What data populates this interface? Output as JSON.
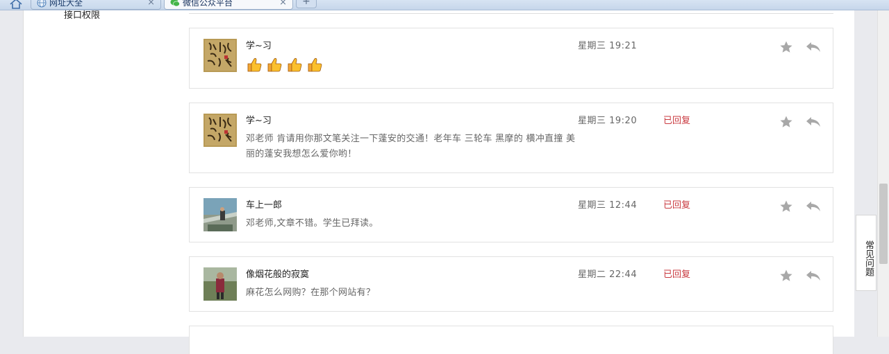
{
  "browser": {
    "tabs": [
      {
        "label": "网址大全",
        "icon": "globe-icon",
        "close": "×"
      },
      {
        "label": "微信公众平台",
        "icon": "wechat-icon",
        "close": "×"
      }
    ],
    "new_tab": "+"
  },
  "sidebar": {
    "items": [
      {
        "label": "接口权限"
      }
    ]
  },
  "messages": [
    {
      "nickname": "学~习",
      "time": "星期三 19:21",
      "status": "",
      "content": "",
      "emoji": [
        "thumbs-up-emoji",
        "thumbs-up-emoji",
        "thumbs-up-emoji",
        "thumbs-up-emoji"
      ]
    },
    {
      "nickname": "学~习",
      "time": "星期三 19:20",
      "status": "已回复",
      "content": "邓老师 肯请用你那文笔关注一下蓬安的交通！老年车 三轮车 黑摩的 横冲直撞 美丽的蓬安我想怎么爱你哟！"
    },
    {
      "nickname": "车上一郎",
      "time": "星期三 12:44",
      "status": "已回复",
      "content": "邓老师,文章不错。学生已拜读。"
    },
    {
      "nickname": "像烟花般的寂寞",
      "time": "星期二 22:44",
      "status": "已回复",
      "content": "麻花怎么网购？在那个网站有？"
    }
  ],
  "faq": {
    "label": "常见问题"
  },
  "colors": {
    "replied": "#c9393f",
    "icon_gray": "#a8a8a8"
  }
}
